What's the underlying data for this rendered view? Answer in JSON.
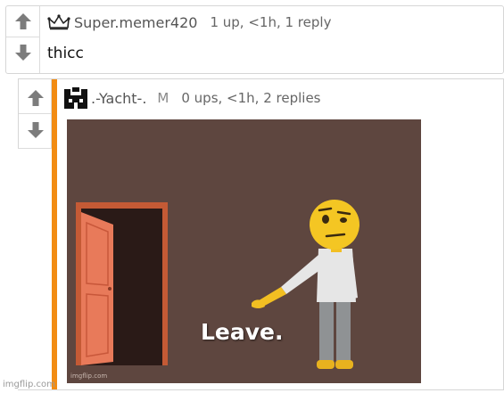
{
  "comments": [
    {
      "username": "Super.memer420",
      "meta": "1 up, <1h, 1 reply",
      "text": "thicc",
      "avatar_icon": "crown-icon"
    },
    {
      "username": ".-Yacht-.",
      "badge": "M",
      "meta": "0 ups, <1h, 2 replies",
      "avatar_icon": "pixel-castle-icon",
      "image": {
        "caption": "Leave.",
        "watermark": "imgflip.com"
      }
    }
  ],
  "footer_watermark": "imgflip.com",
  "colors": {
    "accent_bar": "#f28c13",
    "meme_background": "#5e463f",
    "vote_arrow": "#7c7c7c"
  }
}
